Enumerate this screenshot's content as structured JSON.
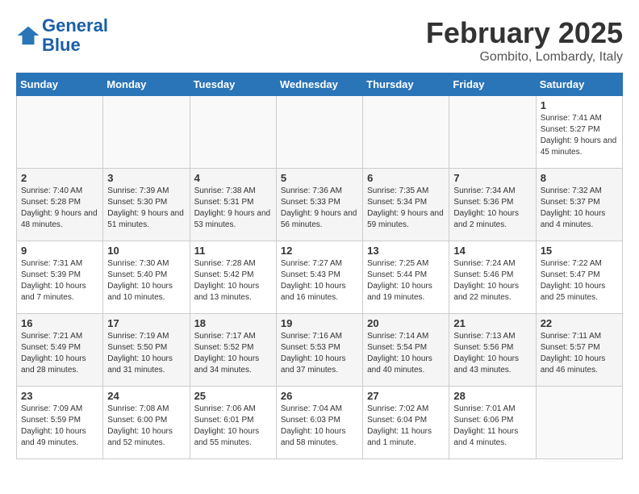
{
  "header": {
    "logo_line1": "General",
    "logo_line2": "Blue",
    "month": "February 2025",
    "location": "Gombito, Lombardy, Italy"
  },
  "weekdays": [
    "Sunday",
    "Monday",
    "Tuesday",
    "Wednesday",
    "Thursday",
    "Friday",
    "Saturday"
  ],
  "weeks": [
    [
      {
        "day": "",
        "info": ""
      },
      {
        "day": "",
        "info": ""
      },
      {
        "day": "",
        "info": ""
      },
      {
        "day": "",
        "info": ""
      },
      {
        "day": "",
        "info": ""
      },
      {
        "day": "",
        "info": ""
      },
      {
        "day": "1",
        "info": "Sunrise: 7:41 AM\nSunset: 5:27 PM\nDaylight: 9 hours and 45 minutes."
      }
    ],
    [
      {
        "day": "2",
        "info": "Sunrise: 7:40 AM\nSunset: 5:28 PM\nDaylight: 9 hours and 48 minutes."
      },
      {
        "day": "3",
        "info": "Sunrise: 7:39 AM\nSunset: 5:30 PM\nDaylight: 9 hours and 51 minutes."
      },
      {
        "day": "4",
        "info": "Sunrise: 7:38 AM\nSunset: 5:31 PM\nDaylight: 9 hours and 53 minutes."
      },
      {
        "day": "5",
        "info": "Sunrise: 7:36 AM\nSunset: 5:33 PM\nDaylight: 9 hours and 56 minutes."
      },
      {
        "day": "6",
        "info": "Sunrise: 7:35 AM\nSunset: 5:34 PM\nDaylight: 9 hours and 59 minutes."
      },
      {
        "day": "7",
        "info": "Sunrise: 7:34 AM\nSunset: 5:36 PM\nDaylight: 10 hours and 2 minutes."
      },
      {
        "day": "8",
        "info": "Sunrise: 7:32 AM\nSunset: 5:37 PM\nDaylight: 10 hours and 4 minutes."
      }
    ],
    [
      {
        "day": "9",
        "info": "Sunrise: 7:31 AM\nSunset: 5:39 PM\nDaylight: 10 hours and 7 minutes."
      },
      {
        "day": "10",
        "info": "Sunrise: 7:30 AM\nSunset: 5:40 PM\nDaylight: 10 hours and 10 minutes."
      },
      {
        "day": "11",
        "info": "Sunrise: 7:28 AM\nSunset: 5:42 PM\nDaylight: 10 hours and 13 minutes."
      },
      {
        "day": "12",
        "info": "Sunrise: 7:27 AM\nSunset: 5:43 PM\nDaylight: 10 hours and 16 minutes."
      },
      {
        "day": "13",
        "info": "Sunrise: 7:25 AM\nSunset: 5:44 PM\nDaylight: 10 hours and 19 minutes."
      },
      {
        "day": "14",
        "info": "Sunrise: 7:24 AM\nSunset: 5:46 PM\nDaylight: 10 hours and 22 minutes."
      },
      {
        "day": "15",
        "info": "Sunrise: 7:22 AM\nSunset: 5:47 PM\nDaylight: 10 hours and 25 minutes."
      }
    ],
    [
      {
        "day": "16",
        "info": "Sunrise: 7:21 AM\nSunset: 5:49 PM\nDaylight: 10 hours and 28 minutes."
      },
      {
        "day": "17",
        "info": "Sunrise: 7:19 AM\nSunset: 5:50 PM\nDaylight: 10 hours and 31 minutes."
      },
      {
        "day": "18",
        "info": "Sunrise: 7:17 AM\nSunset: 5:52 PM\nDaylight: 10 hours and 34 minutes."
      },
      {
        "day": "19",
        "info": "Sunrise: 7:16 AM\nSunset: 5:53 PM\nDaylight: 10 hours and 37 minutes."
      },
      {
        "day": "20",
        "info": "Sunrise: 7:14 AM\nSunset: 5:54 PM\nDaylight: 10 hours and 40 minutes."
      },
      {
        "day": "21",
        "info": "Sunrise: 7:13 AM\nSunset: 5:56 PM\nDaylight: 10 hours and 43 minutes."
      },
      {
        "day": "22",
        "info": "Sunrise: 7:11 AM\nSunset: 5:57 PM\nDaylight: 10 hours and 46 minutes."
      }
    ],
    [
      {
        "day": "23",
        "info": "Sunrise: 7:09 AM\nSunset: 5:59 PM\nDaylight: 10 hours and 49 minutes."
      },
      {
        "day": "24",
        "info": "Sunrise: 7:08 AM\nSunset: 6:00 PM\nDaylight: 10 hours and 52 minutes."
      },
      {
        "day": "25",
        "info": "Sunrise: 7:06 AM\nSunset: 6:01 PM\nDaylight: 10 hours and 55 minutes."
      },
      {
        "day": "26",
        "info": "Sunrise: 7:04 AM\nSunset: 6:03 PM\nDaylight: 10 hours and 58 minutes."
      },
      {
        "day": "27",
        "info": "Sunrise: 7:02 AM\nSunset: 6:04 PM\nDaylight: 11 hours and 1 minute."
      },
      {
        "day": "28",
        "info": "Sunrise: 7:01 AM\nSunset: 6:06 PM\nDaylight: 11 hours and 4 minutes."
      },
      {
        "day": "",
        "info": ""
      }
    ]
  ]
}
